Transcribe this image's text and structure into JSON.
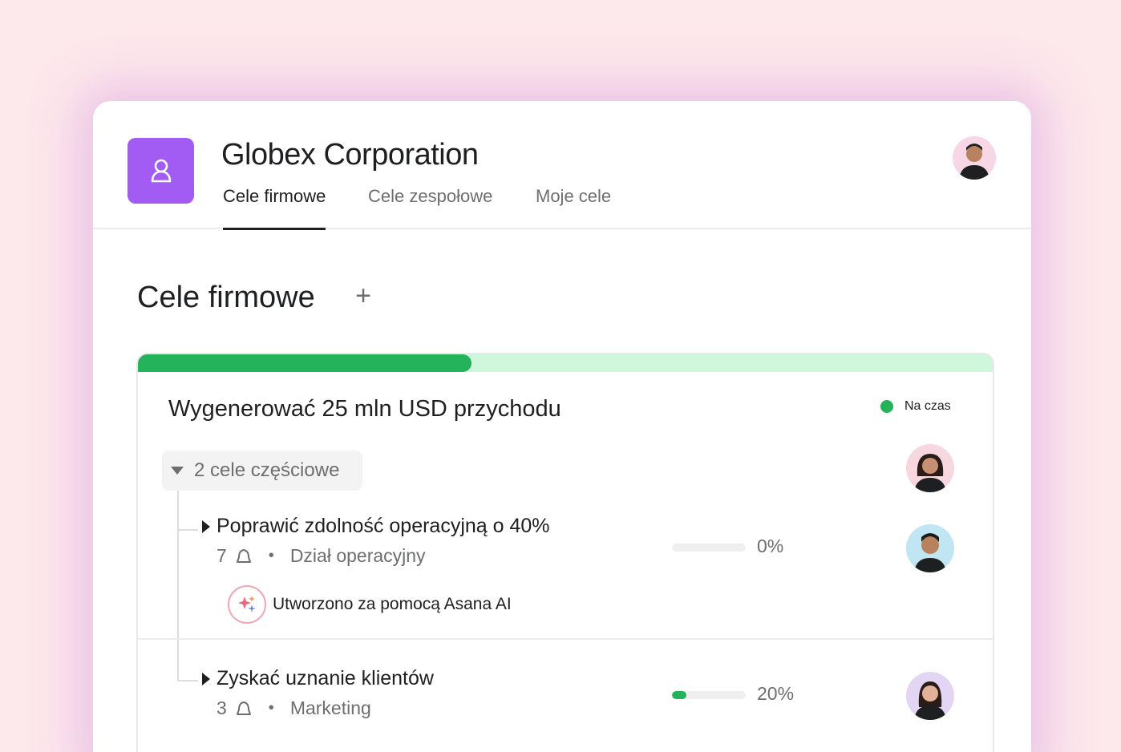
{
  "header": {
    "org_name": "Globex Corporation",
    "tabs": [
      {
        "label": "Cele firmowe",
        "active": true
      },
      {
        "label": "Cele zespołowe",
        "active": false
      },
      {
        "label": "Moje cele",
        "active": false
      }
    ]
  },
  "main": {
    "title": "Cele firmowe",
    "add_label": "+"
  },
  "goal": {
    "title": "Wygenerować 25 mln USD przychodu",
    "progress_fraction": 0.39,
    "status": "Na czas",
    "status_color": "#24b35a",
    "subgoals_label": "2 cele częściowe",
    "subgoals": [
      {
        "title": "Poprawić zdolność operacyjną o 40%",
        "count": "7",
        "team": "Dział operacyjny",
        "progress_fraction": 0.0,
        "pct_label": "0%",
        "ai_note": "Utworzono za pomocą Asana AI"
      },
      {
        "title": "Zyskać uznanie klientów",
        "count": "3",
        "team": "Marketing",
        "progress_fraction": 0.2,
        "pct_label": "20%"
      }
    ]
  },
  "colors": {
    "accent_purple": "#a35cf3",
    "progress_green": "#24b35a",
    "progress_track": "#cff7dc",
    "background_pink": "#fde9ec"
  },
  "icons": [
    "team-logo-icon",
    "plus-icon",
    "caret-down-icon",
    "caret-right-icon",
    "bell-icon",
    "sparkle-ai-icon"
  ]
}
